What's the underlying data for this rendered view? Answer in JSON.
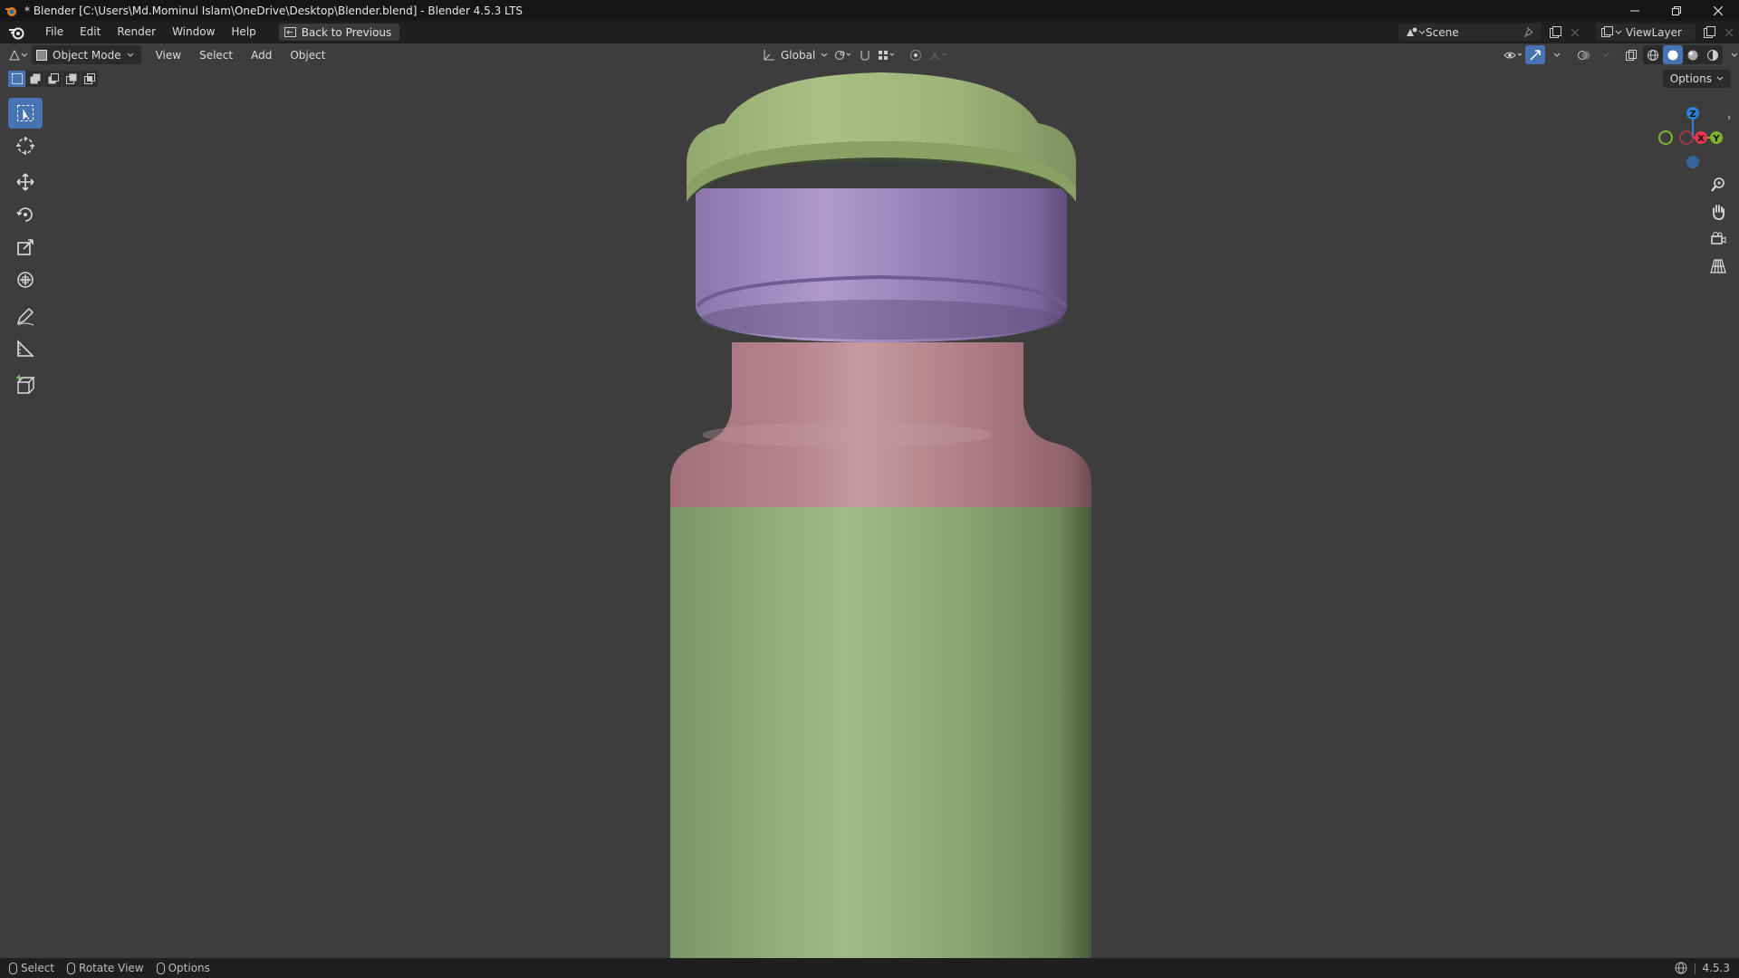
{
  "window": {
    "title": "* Blender [C:\\Users\\Md.Mominul Islam\\OneDrive\\Desktop\\Blender.blend] - Blender 4.5.3 LTS"
  },
  "menubar": {
    "items": [
      "File",
      "Edit",
      "Render",
      "Window",
      "Help"
    ],
    "back_button": "Back to Previous",
    "scene": "Scene",
    "view_layer": "ViewLayer"
  },
  "viewport_header": {
    "mode": "Object Mode",
    "menus": [
      "View",
      "Select",
      "Add",
      "Object"
    ],
    "orientation": "Global",
    "options": "Options"
  },
  "gizmo": {
    "z_label": "Z",
    "x_label": "X",
    "y_label": "Y",
    "colors": {
      "x": "#e8364c",
      "y": "#7fb32e",
      "z": "#2f7fd8"
    }
  },
  "statusbar": {
    "items": [
      "Select",
      "Rotate View",
      "Options"
    ],
    "version": "4.5.3"
  },
  "colors": {
    "accent": "#4772b3",
    "viewport_bg": "#3d3d3d",
    "cap_top": "#a5b97c",
    "cap_ring": "#9b87bd",
    "neck": "#b1808a",
    "body": "#8fab79"
  }
}
